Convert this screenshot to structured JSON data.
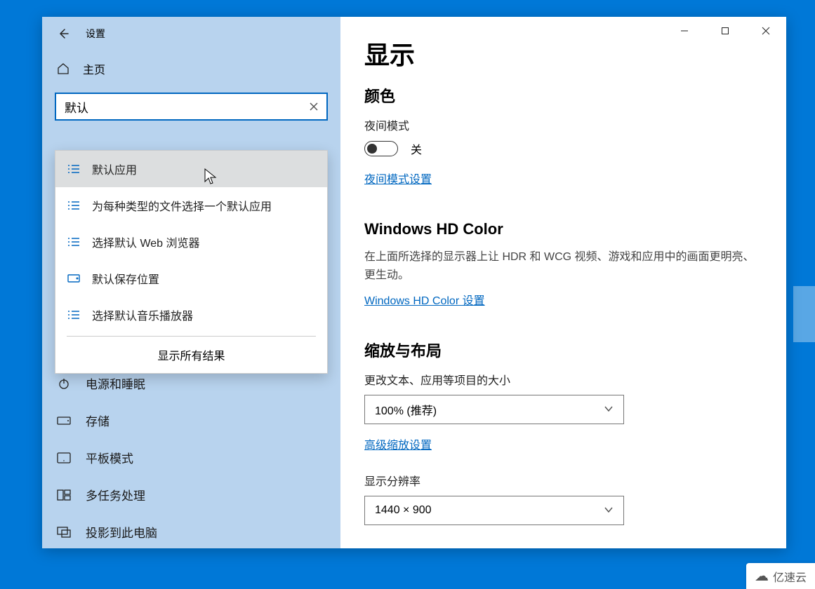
{
  "window": {
    "back_aria": "返回",
    "title": "设置",
    "controls": {
      "min": "最小化",
      "max": "最大化",
      "close": "关闭"
    }
  },
  "left": {
    "home_label": "主页",
    "search_value": "默认",
    "search_clear_aria": "清除",
    "suggestions": {
      "items": [
        {
          "icon": "list",
          "label": "默认应用"
        },
        {
          "icon": "list",
          "label": "为每种类型的文件选择一个默认应用"
        },
        {
          "icon": "list",
          "label": "选择默认 Web 浏览器"
        },
        {
          "icon": "drive",
          "label": "默认保存位置"
        },
        {
          "icon": "list",
          "label": "选择默认音乐播放器"
        }
      ],
      "show_all": "显示所有结果"
    },
    "nav": [
      {
        "icon": "power",
        "label": "电源和睡眠"
      },
      {
        "icon": "storage",
        "label": "存储"
      },
      {
        "icon": "tablet",
        "label": "平板模式"
      },
      {
        "icon": "multi",
        "label": "多任务处理"
      },
      {
        "icon": "project",
        "label": "投影到此电脑"
      }
    ]
  },
  "right": {
    "page_title": "显示",
    "color_heading": "颜色",
    "night_label": "夜间模式",
    "toggle_state": "关",
    "night_settings_link": "夜间模式设置",
    "hd_heading": "Windows HD Color",
    "hd_desc": "在上面所选择的显示器上让 HDR 和 WCG 视频、游戏和应用中的画面更明亮、更生动。",
    "hd_link": "Windows HD Color 设置",
    "scale_heading": "缩放与布局",
    "scale_label": "更改文本、应用等项目的大小",
    "scale_value": "100% (推荐)",
    "adv_scale_link": "高级缩放设置",
    "res_label": "显示分辨率",
    "res_value": "1440 × 900"
  },
  "watermark": "亿速云"
}
